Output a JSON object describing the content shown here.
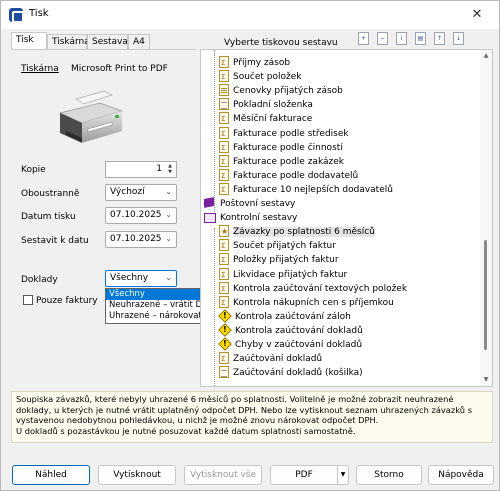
{
  "window": {
    "title": "Tisk"
  },
  "tabs": [
    {
      "label": "Tisk",
      "active": true
    },
    {
      "label": "Tiskárna"
    },
    {
      "label": "Sestava"
    },
    {
      "label": "A4"
    }
  ],
  "left": {
    "printer_label": "Tiskárna",
    "printer_name": "Microsoft Print to PDF",
    "kopie_label": "Kopie",
    "kopie_value": "1",
    "oboustranne_label": "Oboustranně",
    "oboustranne_value": "Výchozí",
    "datum_tisku_label": "Datum tisku",
    "datum_tisku_value": "07.10.2025",
    "sestavit_label": "Sestavit k datu",
    "sestavit_value": "07.10.2025",
    "doklady_label": "Doklady",
    "doklady_value": "Všechny",
    "doklady_options": [
      "Všechny",
      "Neuhrazené – vrátit DPH",
      "Uhrazené – nárokovat DPH"
    ],
    "pouze_faktury_label": "Pouze faktury",
    "pouze_faktury_checked": false
  },
  "right": {
    "header": "Vyberte tiskovou sestavu",
    "toolbar_icons": [
      "add-report-icon",
      "remove-report-icon",
      "report-info-icon",
      "report-copy-icon",
      "move-up-icon",
      "move-down-icon"
    ],
    "tree": [
      {
        "label": "Příjmy zásob",
        "icon": "sum",
        "level": 1
      },
      {
        "label": "Součet položek",
        "icon": "sum",
        "level": 1
      },
      {
        "label": "Cenovky přijatých zásob",
        "icon": "grid",
        "level": 1
      },
      {
        "label": "Pokladní složenka",
        "icon": "doc",
        "level": 1
      },
      {
        "label": "Měsíční fakturace",
        "icon": "sum",
        "level": 1
      },
      {
        "label": "Fakturace podle středisek",
        "icon": "sum",
        "level": 1
      },
      {
        "label": "Fakturace podle činností",
        "icon": "sum",
        "level": 1
      },
      {
        "label": "Fakturace podle zakázek",
        "icon": "sum",
        "level": 1
      },
      {
        "label": "Fakturace podle dodavatelů",
        "icon": "sum",
        "level": 1
      },
      {
        "label": "Fakturace 10 nejlepších dodavatelů",
        "icon": "sum",
        "level": 1
      },
      {
        "label": "Poštovní sestavy",
        "icon": "book",
        "level": 0
      },
      {
        "label": "Kontrolní sestavy",
        "icon": "book-open",
        "level": 0
      },
      {
        "label": "Závazky po splatnosti 6 měsíců",
        "icon": "star",
        "level": 1,
        "selected": true
      },
      {
        "label": "Součet přijatých faktur",
        "icon": "sum",
        "level": 1
      },
      {
        "label": "Položky přijatých faktur",
        "icon": "sum",
        "level": 1
      },
      {
        "label": "Likvidace přijatých faktur",
        "icon": "sum",
        "level": 1
      },
      {
        "label": "Kontrola zaúčtování textových položek",
        "icon": "sum",
        "level": 1
      },
      {
        "label": "Kontrola nákupních cen s příjemkou",
        "icon": "sum",
        "level": 1
      },
      {
        "label": "Kontrola zaúčtování záloh",
        "icon": "warn",
        "level": 1
      },
      {
        "label": "Kontrola zaúčtování dokladů",
        "icon": "warn",
        "level": 1
      },
      {
        "label": "Chyby v zaúčtování dokladů",
        "icon": "warn",
        "level": 1
      },
      {
        "label": "Zaúčtování dokladů",
        "icon": "sum",
        "level": 1
      },
      {
        "label": "Zaúčtování dokladů (košilka)",
        "icon": "doc",
        "level": 1
      }
    ]
  },
  "description": [
    "Soupiska závazků, které nebyly uhrazené 6 měsíců po splatnosti. Volitelně je možné zobrazit neuhrazené doklady, u kterých je nutné vrátit uplatněný odpočet DPH. Nebo lze vytisknout seznam uhrazených závazků s vystavenou nedobytnou pohledávkou, u nichž je možné znovu nárokovat odpočet DPH.",
    "U dokladů s pozastávkou je nutné posuzovat každé datum splatnosti samostatně."
  ],
  "buttons": {
    "nahled": "Náhled",
    "vytisknout": "Vytisknout",
    "vytisknout_vse": "Vytisknout vše",
    "pdf": "PDF",
    "storno": "Storno",
    "napoveda": "Nápověda"
  }
}
